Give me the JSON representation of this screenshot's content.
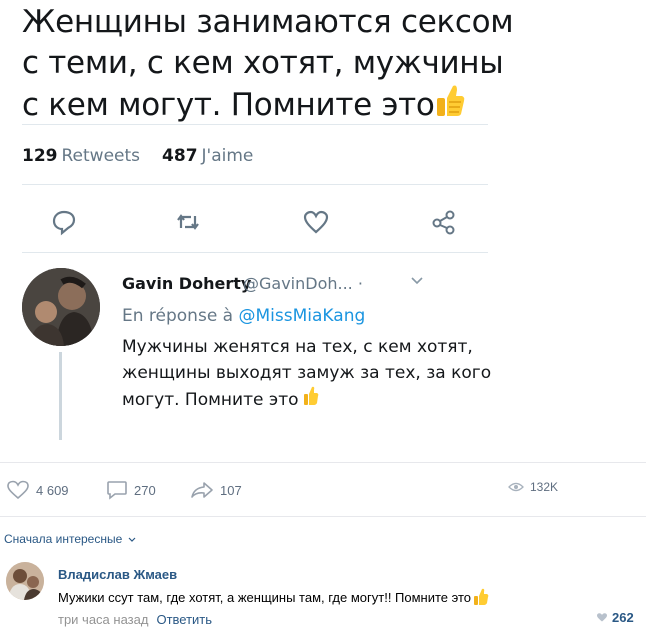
{
  "tweet": {
    "lines": [
      "Женщины занимаются сексом",
      "с теми, с кем хотят, мужчины",
      "с кем могут. Помните это"
    ],
    "retweets_count": "129",
    "retweets_label": "Retweets",
    "likes_count": "487",
    "likes_label": "J'aime"
  },
  "reply": {
    "author_name": "Gavin Doherty",
    "author_handle": "@GavinDoh... ·",
    "reply_prefix": "En réponse à",
    "reply_mention": "@MissMiaKang",
    "lines": [
      "Мужчины женятся на тех, с кем хотят,",
      "женщины выходят замуж за тех, за кого",
      "могут. Помните это"
    ]
  },
  "vk_stats": {
    "likes": "4 609",
    "comments": "270",
    "reposts": "107",
    "views": "132K"
  },
  "comments_sort": "Сначала интересные",
  "comment": {
    "author": "Владислав Жмаев",
    "text": "Мужики ссут там, где хотят, а женщины там, где могут!! Помните это",
    "time": "три часа назад",
    "reply_label": "Ответить",
    "likes": "262"
  },
  "colors": {
    "vk_link": "#2a5885",
    "twitter_link": "#1b95e0",
    "muted": "#657786"
  },
  "icons": [
    "reply-icon",
    "retweet-icon",
    "heart-icon",
    "share-icon",
    "thumbs-up-icon",
    "chevron-down-icon",
    "eye-icon",
    "comment-icon",
    "repost-icon"
  ]
}
